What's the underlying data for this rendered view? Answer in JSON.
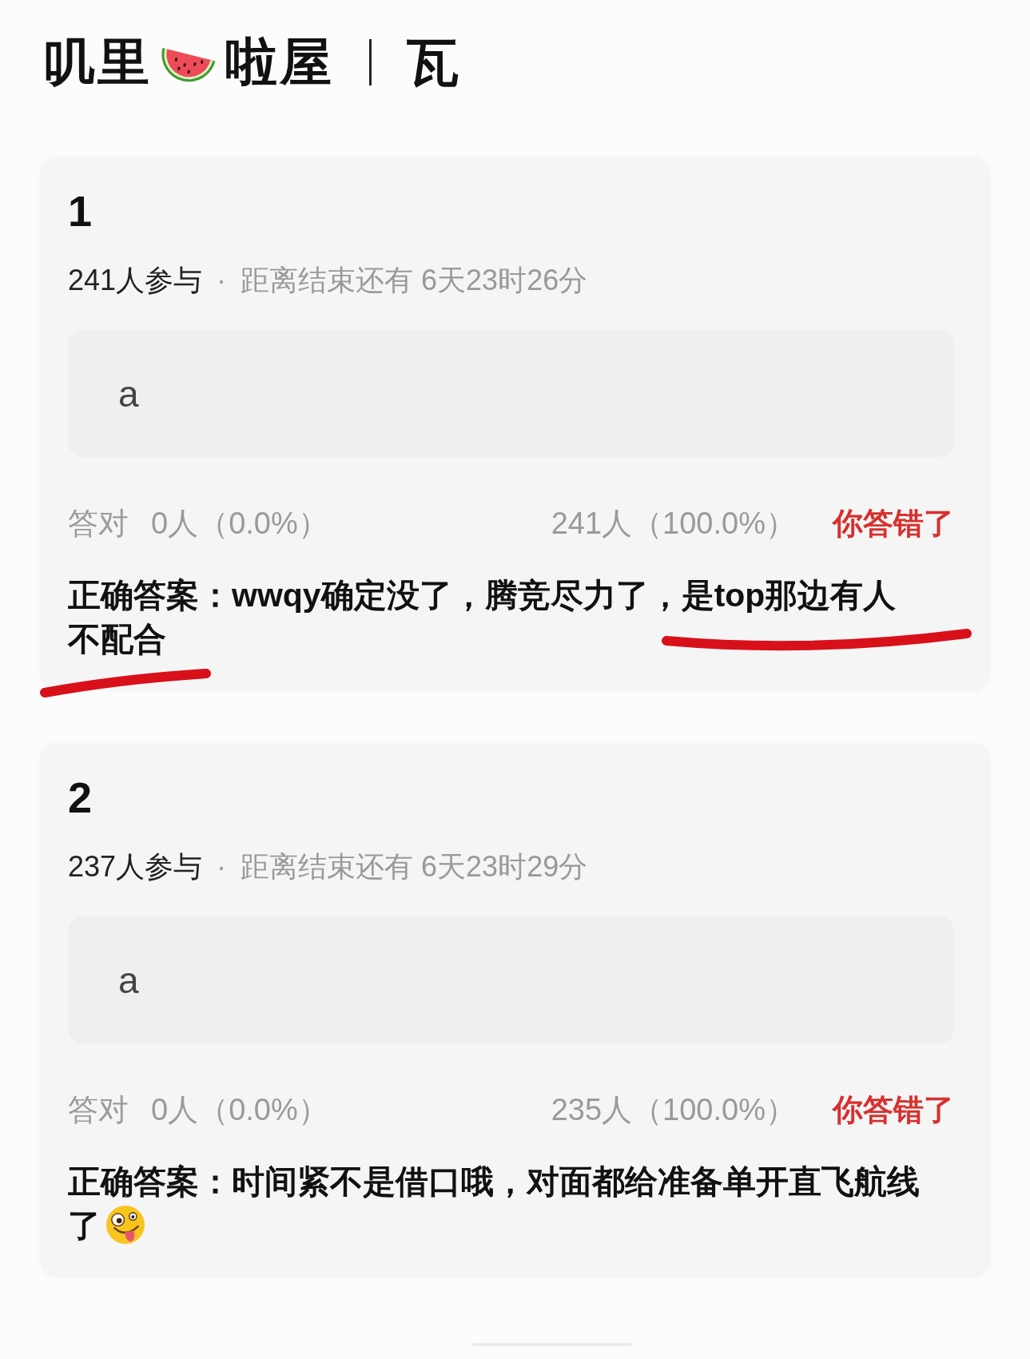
{
  "header": {
    "title_start": "叽里",
    "title_end": "啦屋",
    "section": "瓦"
  },
  "questions": [
    {
      "number": "1",
      "participants": "241人参与",
      "separator": "·",
      "countdown": "距离结束还有 6天23时26分",
      "options": [
        {
          "label": "a"
        }
      ],
      "correct_label": "答对",
      "correct_count": "0人（0.0%）",
      "wrong_count": "241人（100.0%）",
      "result": "你答错了",
      "answered_correctly": false,
      "answer": "正确答案：wwqy确定没了，腾竞尽力了，是top那边有人不配合",
      "trailing_emoji": false,
      "marked": true
    },
    {
      "number": "2",
      "participants": "237人参与",
      "separator": "·",
      "countdown": "距离结束还有 6天23时29分",
      "options": [
        {
          "label": "a"
        }
      ],
      "correct_label": "答对",
      "correct_count": "0人（0.0%）",
      "wrong_count": "235人（100.0%）",
      "result": "你答错了",
      "answered_correctly": false,
      "answer": "正确答案：时间紧不是借口哦，对面都给准备单开直飞航线了",
      "trailing_emoji": true,
      "marked": false
    }
  ]
}
